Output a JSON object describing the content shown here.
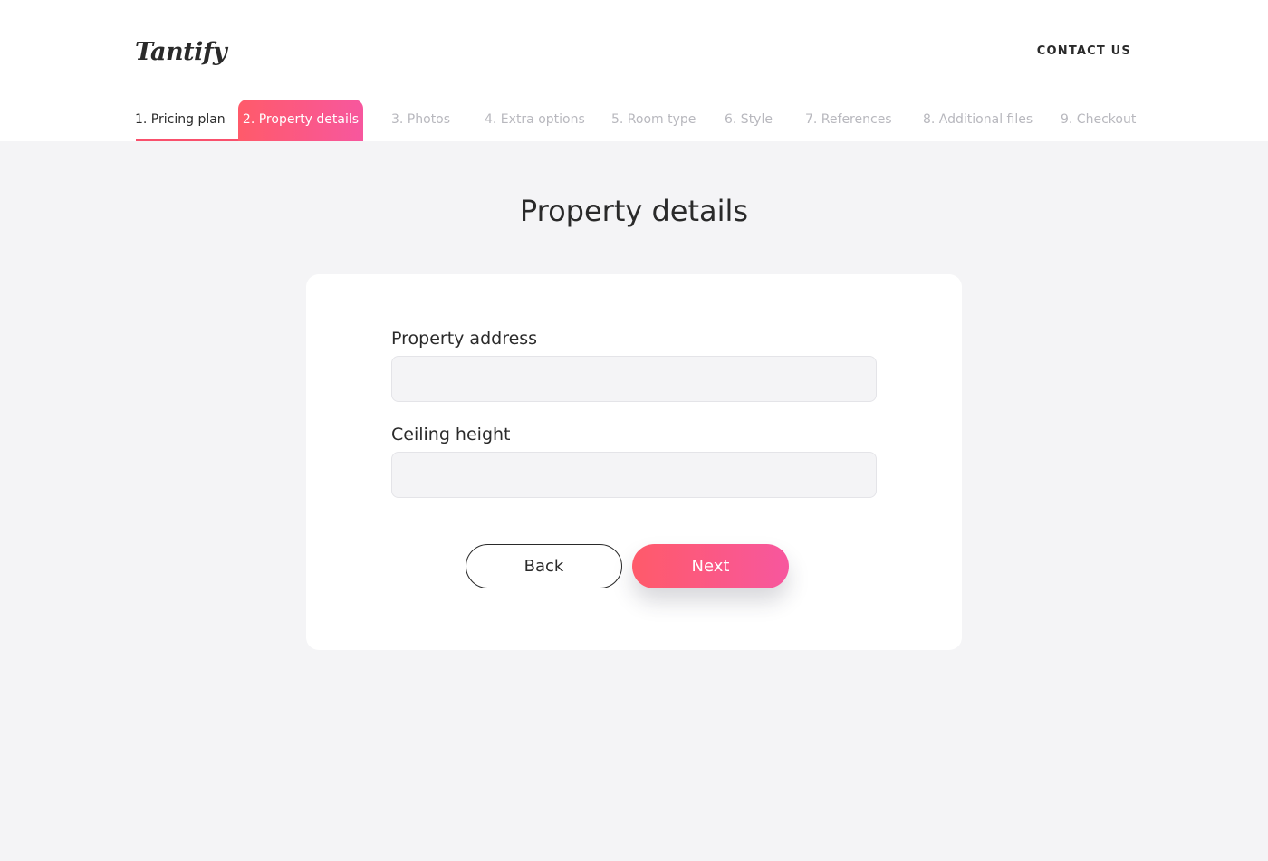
{
  "brand": {
    "logo_text": "Tantify",
    "accent_color": "#f9506c",
    "accent_gradient_end": "#f7579e"
  },
  "header": {
    "contact_label": "CONTACT US"
  },
  "steps": [
    {
      "label": "1. Pricing plan",
      "state": "done"
    },
    {
      "label": "2. Property details",
      "state": "active"
    },
    {
      "label": "3. Photos",
      "state": "upcoming"
    },
    {
      "label": "4. Extra options",
      "state": "upcoming"
    },
    {
      "label": "5. Room type",
      "state": "upcoming"
    },
    {
      "label": "6. Style",
      "state": "upcoming"
    },
    {
      "label": "7. References",
      "state": "upcoming"
    },
    {
      "label": "8. Additional files",
      "state": "upcoming"
    },
    {
      "label": "9. Checkout",
      "state": "upcoming"
    }
  ],
  "page": {
    "title": "Property details"
  },
  "form": {
    "address_label": "Property address",
    "address_value": "",
    "address_placeholder": "",
    "ceiling_label": "Ceiling height",
    "ceiling_value": "",
    "ceiling_placeholder": ""
  },
  "actions": {
    "back_label": "Back",
    "next_label": "Next"
  }
}
